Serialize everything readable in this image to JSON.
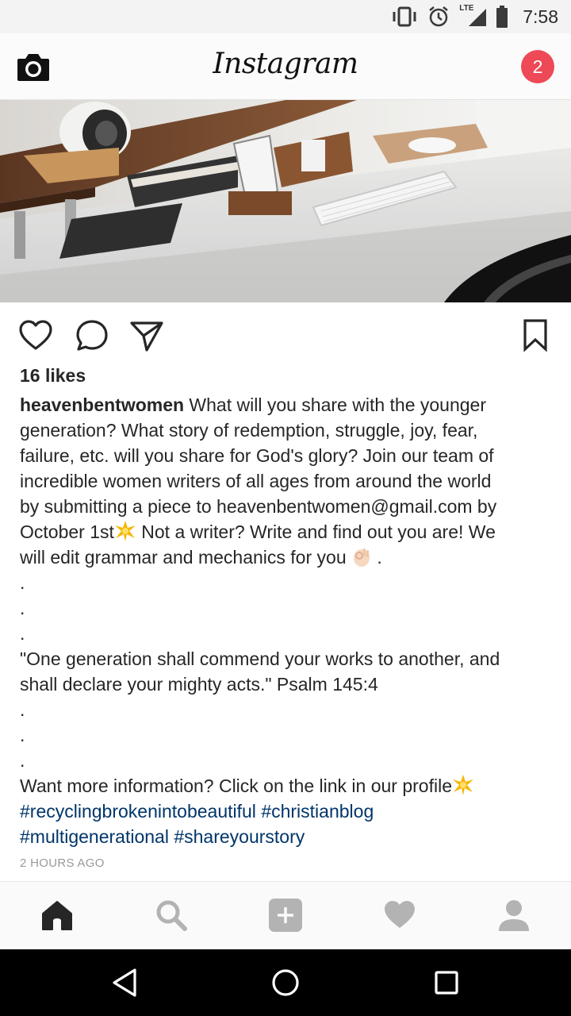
{
  "status_bar": {
    "time": "7:58",
    "network_label": "LTE",
    "icons": [
      "vibrate-icon",
      "alarm-icon",
      "signal-icon",
      "battery-icon"
    ]
  },
  "header": {
    "logo_text": "Instagram",
    "notification_count": "2",
    "icons": [
      "camera-icon"
    ]
  },
  "post": {
    "image_alt": "desk-workspace-photo",
    "actions": [
      "heart-icon",
      "comment-icon",
      "share-icon",
      "bookmark-icon"
    ],
    "likes": "16 likes",
    "username": "heavenbentwomen",
    "caption_lines": [
      " What will you share with the younger",
      "generation? What story of redemption, struggle, joy, fear,",
      "failure, etc. will you share for God's glory? Join our team of",
      "incredible women writers of all ages from around the world",
      "by submitting a piece to heavenbentwomen@gmail.com by",
      "October 1st",
      " Not a writer? Write and find out you are! We",
      "will edit grammar and mechanics for you ",
      " .",
      ".",
      ".",
      ".",
      "\"One generation shall commend your works to another, and",
      "shall declare your mighty acts.\" Psalm 145:4",
      ".",
      ".",
      ".",
      "Want more information? Click on the link in our profile"
    ],
    "hashtags": [
      "#recyclingbrokenintobeautiful",
      "#christianblog",
      "#multigenerational",
      "#shareyourstory"
    ],
    "timestamp": "2 HOURS AGO"
  },
  "tab_bar": {
    "tabs": [
      "home-icon",
      "search-icon",
      "add-icon",
      "activity-heart-icon",
      "profile-icon"
    ],
    "active": "home-icon"
  },
  "nav_bar": {
    "buttons": [
      "back-icon",
      "home-circle-icon",
      "recents-icon"
    ]
  },
  "colors": {
    "badge": "#ed4956",
    "hashtag": "#003569",
    "timestamp": "#999999",
    "text": "#262626"
  }
}
